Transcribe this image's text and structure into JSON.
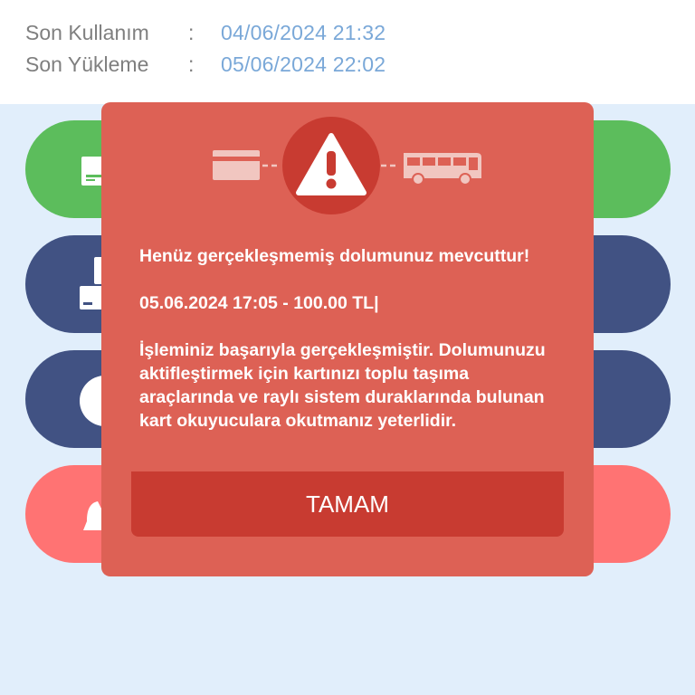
{
  "info": {
    "last_use_label": "Son Kullanım",
    "last_use_value": "04/06/2024 21:32",
    "last_load_label": "Son Yükleme",
    "last_load_value": "05/06/2024 22:02",
    "separator": ":"
  },
  "menu": {
    "pills": [
      {
        "color": "#5cbd5c",
        "icon": "card-load-icon"
      },
      {
        "color": "#415283",
        "icon": "card-reader-icon"
      },
      {
        "color": "#415283",
        "icon": "circle-icon"
      },
      {
        "color": "#ff7373",
        "icon": "bell-icon"
      }
    ]
  },
  "dialog": {
    "icons": [
      "card-icon",
      "warning-icon",
      "bus-icon"
    ],
    "message_line1": "Henüz gerçekleşmemiş dolumunuz mevcuttur!",
    "message_line2": "05.06.2024 17:05 - 100.00 TL|",
    "message_line3": "İşleminiz başarıyla gerçekleşmiştir. Dolumunuzu aktifleştirmek için kartınızı toplu taşıma araçlarında ve raylı sistem duraklarında bulunan kart okuyuculara okutmanız yeterlidir.",
    "button_label": "TAMAM",
    "colors": {
      "background": "#dd6155",
      "button": "#c83b31",
      "warning_circle": "#c83b31"
    }
  }
}
